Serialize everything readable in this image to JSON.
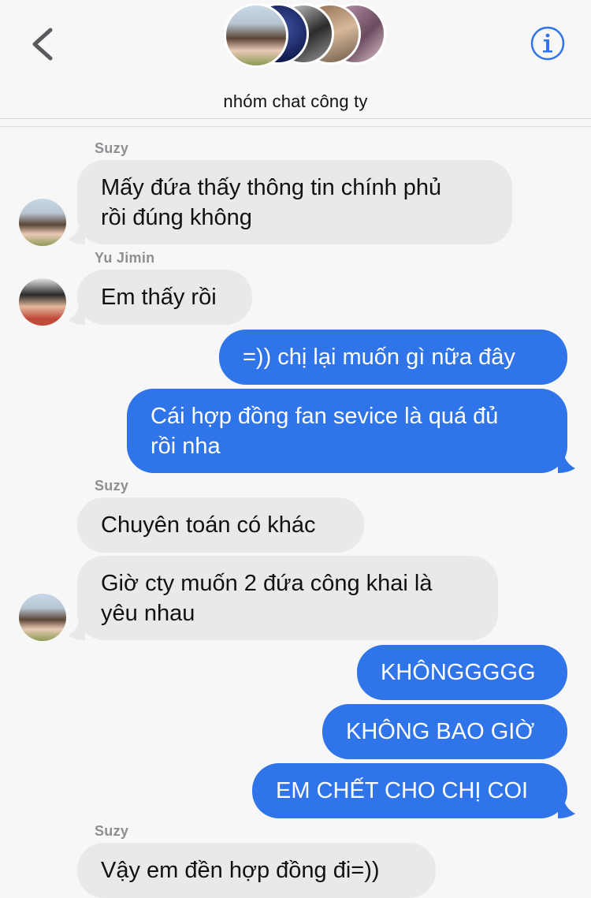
{
  "header": {
    "title": "nhóm chat công ty",
    "back_icon": "chevron-left-icon",
    "info_icon": "info-circle-icon",
    "accent": "#2f74e8"
  },
  "messages": [
    {
      "id": "m1",
      "direction": "incoming",
      "sender": "Suzy",
      "text": "Mấy đứa thấy thông tin chính phủ\nrồi đúng không"
    },
    {
      "id": "m2",
      "direction": "incoming",
      "sender": "Yu Jimin",
      "text": "Em thấy rồi"
    },
    {
      "id": "m3",
      "direction": "outgoing",
      "text": "=)) chị lại muốn gì nữa đây"
    },
    {
      "id": "m4",
      "direction": "outgoing",
      "text": "Cái hợp đồng fan sevice là quá đủ\nrồi nha"
    },
    {
      "id": "m5",
      "direction": "incoming",
      "sender": "Suzy",
      "text": "Chuyên toán có khác"
    },
    {
      "id": "m6",
      "direction": "incoming",
      "text": "Giờ cty muốn 2 đứa công khai là\nyêu nhau"
    },
    {
      "id": "m7",
      "direction": "outgoing",
      "text": "KHÔNGGGGG"
    },
    {
      "id": "m8",
      "direction": "outgoing",
      "text": "KHÔNG BAO GIỜ"
    },
    {
      "id": "m9",
      "direction": "outgoing",
      "text": "EM CHẾT CHO CHỊ COI"
    },
    {
      "id": "m10",
      "direction": "incoming",
      "sender": "Suzy",
      "text": "Vậy em đền hợp đồng đi=))"
    }
  ],
  "colors": {
    "incoming_bubble": "#e9e9eb",
    "outgoing_bubble": "#2f74e8",
    "sender_name": "#8e8e93"
  }
}
